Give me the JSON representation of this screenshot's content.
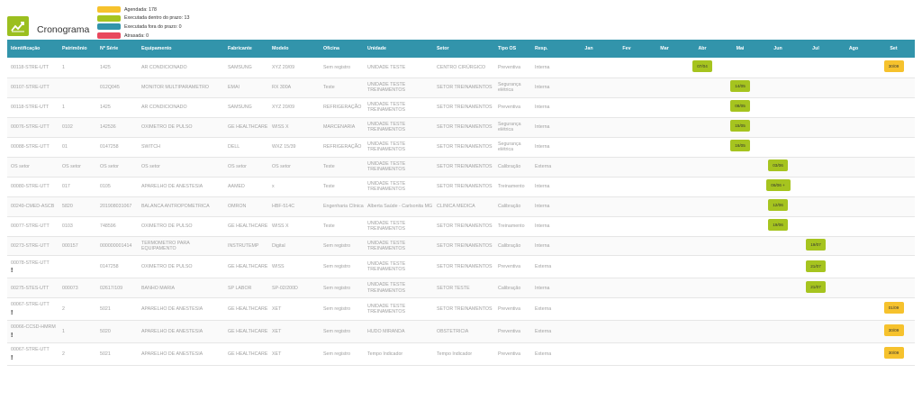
{
  "app": {
    "title": "Cronograma",
    "logo_icon": "chart-icon"
  },
  "legend": [
    {
      "label": "Agendada: 178",
      "color": "#f6c22d"
    },
    {
      "label": "Executada dentro do prazo: 13",
      "color": "#a6c41f"
    },
    {
      "label": "Executada fora do prazo: 0",
      "color": "#3294ab"
    },
    {
      "label": "Atrasada: 0",
      "color": "#e8485d"
    }
  ],
  "columns": [
    "Identificação",
    "Patrimônio",
    "Nº Série",
    "Equipamento",
    "Fabricante",
    "Modelo",
    "Oficina",
    "Unidade",
    "Setor",
    "Tipo OS",
    "Resp."
  ],
  "months": [
    "Jan",
    "Fev",
    "Mar",
    "Abr",
    "Mai",
    "Jun",
    "Jul",
    "Ago",
    "Set"
  ],
  "rows": [
    {
      "id": "00118-STRE-UTT",
      "alert": false,
      "patrimonio": "1",
      "serie": "1425",
      "equipamento": "AR CONDICIONADO",
      "fabricante": "SAMSUNG",
      "modelo": "XYZ 20/09",
      "oficina": "Sem registro",
      "unidade": "UNIDADE TESTE",
      "setor": "CENTRO CIRÚRGICO",
      "tipo": "Preventiva",
      "resp": "Interna",
      "chips": [
        {
          "month": 3,
          "label": "07/04",
          "color": "green"
        },
        {
          "month": 8,
          "label": "30/09",
          "color": "yellow"
        }
      ]
    },
    {
      "id": "00107-STRE-UTT",
      "alert": false,
      "patrimonio": "",
      "serie": "012Q045",
      "equipamento": "MONITOR MULTIPARAMETRO",
      "fabricante": "EMAI",
      "modelo": "RX 300A",
      "oficina": "Teste",
      "unidade": "UNIDADE TESTE TREINAMENTOS",
      "setor": "SETOR TREINAMENTOS",
      "tipo": "Segurança elétrica",
      "resp": "Interna",
      "chips": [
        {
          "month": 4,
          "label": "14/05",
          "color": "green"
        }
      ]
    },
    {
      "id": "00118-STRE-UTT",
      "alert": false,
      "patrimonio": "1",
      "serie": "1425",
      "equipamento": "AR CONDICIONADO",
      "fabricante": "SAMSUNG",
      "modelo": "XYZ 20/09",
      "oficina": "REFRIGERAÇÃO",
      "unidade": "UNIDADE TESTE TREINAMENTOS",
      "setor": "SETOR TREINAMENTOS",
      "tipo": "Preventiva",
      "resp": "Interna",
      "chips": [
        {
          "month": 4,
          "label": "08/05",
          "color": "green"
        }
      ]
    },
    {
      "id": "00076-STRE-UTT",
      "alert": false,
      "patrimonio": "0102",
      "serie": "142536",
      "equipamento": "OXIMETRO DE PULSO",
      "fabricante": "GE HEALTHCARE",
      "modelo": "WISS X",
      "oficina": "MARCENARIA",
      "unidade": "UNIDADE TESTE TREINAMENTOS",
      "setor": "SETOR TREINAMENTOS",
      "tipo": "Segurança elétrica",
      "resp": "Interna",
      "chips": [
        {
          "month": 4,
          "label": "15/05",
          "color": "green"
        }
      ]
    },
    {
      "id": "00088-STRE-UTT",
      "alert": false,
      "patrimonio": "01",
      "serie": "0147258",
      "equipamento": "SWITCH",
      "fabricante": "DELL",
      "modelo": "WXZ 15/39",
      "oficina": "REFRIGERAÇÃO",
      "unidade": "UNIDADE TESTE TREINAMENTOS",
      "setor": "SETOR TREINAMENTOS",
      "tipo": "Segurança elétrica",
      "resp": "Interna",
      "chips": [
        {
          "month": 4,
          "label": "16/05",
          "color": "green"
        }
      ]
    },
    {
      "id": "OS setor",
      "alert": false,
      "patrimonio": "OS setor",
      "serie": "OS setor",
      "equipamento": "OS setor",
      "fabricante": "OS setor",
      "modelo": "OS setor",
      "oficina": "Teste",
      "unidade": "UNIDADE TESTE TREINAMENTOS",
      "setor": "SETOR TREINAMENTOS",
      "tipo": "Calibração",
      "resp": "Externa",
      "chips": [
        {
          "month": 5,
          "label": "03/06",
          "color": "green"
        }
      ]
    },
    {
      "id": "00080-STRE-UTT",
      "alert": false,
      "patrimonio": "017",
      "serie": "0105",
      "equipamento": "APARELHO DE ANESTESIA",
      "fabricante": "AAMED",
      "modelo": "x",
      "oficina": "Teste",
      "unidade": "UNIDADE TESTE TREINAMENTOS",
      "setor": "SETOR TREINAMENTOS",
      "tipo": "Treinamento",
      "resp": "Interna",
      "chips": [
        {
          "month": 5,
          "label": "06/06 +",
          "color": "green",
          "wide": true
        }
      ]
    },
    {
      "id": "00249-CMED-ASCB",
      "alert": false,
      "patrimonio": "5820",
      "serie": "201908031067",
      "equipamento": "BALANCA ANTROPOMETRICA",
      "fabricante": "OMRON",
      "modelo": "HBF-514C",
      "oficina": "Engenharia Clínica",
      "unidade": "Alberta Saúde - Carlsonita MG",
      "setor": "CLINICA MEDICA",
      "tipo": "Calibração",
      "resp": "Interna",
      "chips": [
        {
          "month": 5,
          "label": "12/06",
          "color": "green"
        }
      ]
    },
    {
      "id": "00077-STRE-UTT",
      "alert": false,
      "patrimonio": "0103",
      "serie": "748596",
      "equipamento": "OXIMETRO DE PULSO",
      "fabricante": "GE HEALTHCARE",
      "modelo": "WISS X",
      "oficina": "Teste",
      "unidade": "UNIDADE TESTE TREINAMENTOS",
      "setor": "SETOR TREINAMENTOS",
      "tipo": "Treinamento",
      "resp": "Interna",
      "chips": [
        {
          "month": 5,
          "label": "19/06",
          "color": "green"
        }
      ]
    },
    {
      "id": "00273-STRE-UTT",
      "alert": false,
      "patrimonio": "000157",
      "serie": "000000001414",
      "equipamento": "TERMOMETRO PARA EQUIPAMENTO",
      "fabricante": "INSTRUTEMP",
      "modelo": "Digital",
      "oficina": "Sem registro",
      "unidade": "UNIDADE TESTE TREINAMENTOS",
      "setor": "SETOR TREINAMENTOS",
      "tipo": "Calibração",
      "resp": "Interna",
      "chips": [
        {
          "month": 6,
          "label": "19/07",
          "color": "green"
        }
      ]
    },
    {
      "id": "00078-STRE-UTT",
      "alert": true,
      "patrimonio": "",
      "serie": "0147258",
      "equipamento": "OXIMETRO DE PULSO",
      "fabricante": "GE HEALTHCARE",
      "modelo": "WISS",
      "oficina": "Sem registro",
      "unidade": "UNIDADE TESTE TREINAMENTOS",
      "setor": "SETOR TREINAMENTOS",
      "tipo": "Preventiva",
      "resp": "Externa",
      "chips": [
        {
          "month": 6,
          "label": "21/07",
          "color": "green"
        }
      ]
    },
    {
      "id": "00275-STES-UTT",
      "alert": false,
      "patrimonio": "000073",
      "serie": "02617/109",
      "equipamento": "BANHO MARIA",
      "fabricante": "SP LABOR",
      "modelo": "SP-02/200D",
      "oficina": "Sem registro",
      "unidade": "UNIDADE TESTE TREINAMENTOS",
      "setor": "SETOR TESTE",
      "tipo": "Calibração",
      "resp": "Interna",
      "chips": [
        {
          "month": 6,
          "label": "21/07",
          "color": "green"
        }
      ]
    },
    {
      "id": "00067-STRE-UTT",
      "alert": true,
      "patrimonio": "2",
      "serie": "5021",
      "equipamento": "APARELHO DE ANESTESIA",
      "fabricante": "GE HEALTHCARE",
      "modelo": "XET",
      "oficina": "Sem registro",
      "unidade": "UNIDADE TESTE TREINAMENTOS",
      "setor": "SETOR TREINAMENTOS",
      "tipo": "Preventiva",
      "resp": "Externa",
      "chips": [
        {
          "month": 8,
          "label": "01/09",
          "color": "yellow"
        }
      ]
    },
    {
      "id": "00066-CCSD-HMRM",
      "alert": true,
      "patrimonio": "1",
      "serie": "5020",
      "equipamento": "APARELHO DE ANESTESIA",
      "fabricante": "GE HEALTHCARE",
      "modelo": "XET",
      "oficina": "Sem registro",
      "unidade": "HUDO MIRANDA",
      "setor": "OBSTETRICIA",
      "tipo": "Preventiva",
      "resp": "Externa",
      "chips": [
        {
          "month": 8,
          "label": "30/09",
          "color": "yellow"
        }
      ]
    },
    {
      "id": "00067-STRE-UTT",
      "alert": true,
      "patrimonio": "2",
      "serie": "5021",
      "equipamento": "APARELHO DE ANESTESIA",
      "fabricante": "GE HEALTHCARE",
      "modelo": "XET",
      "oficina": "Sem registro",
      "unidade": "Tempo Indicador",
      "setor": "Tempo Indicador",
      "tipo": "Preventiva",
      "resp": "Externa",
      "chips": [
        {
          "month": 8,
          "label": "30/09",
          "color": "yellow"
        }
      ]
    }
  ]
}
